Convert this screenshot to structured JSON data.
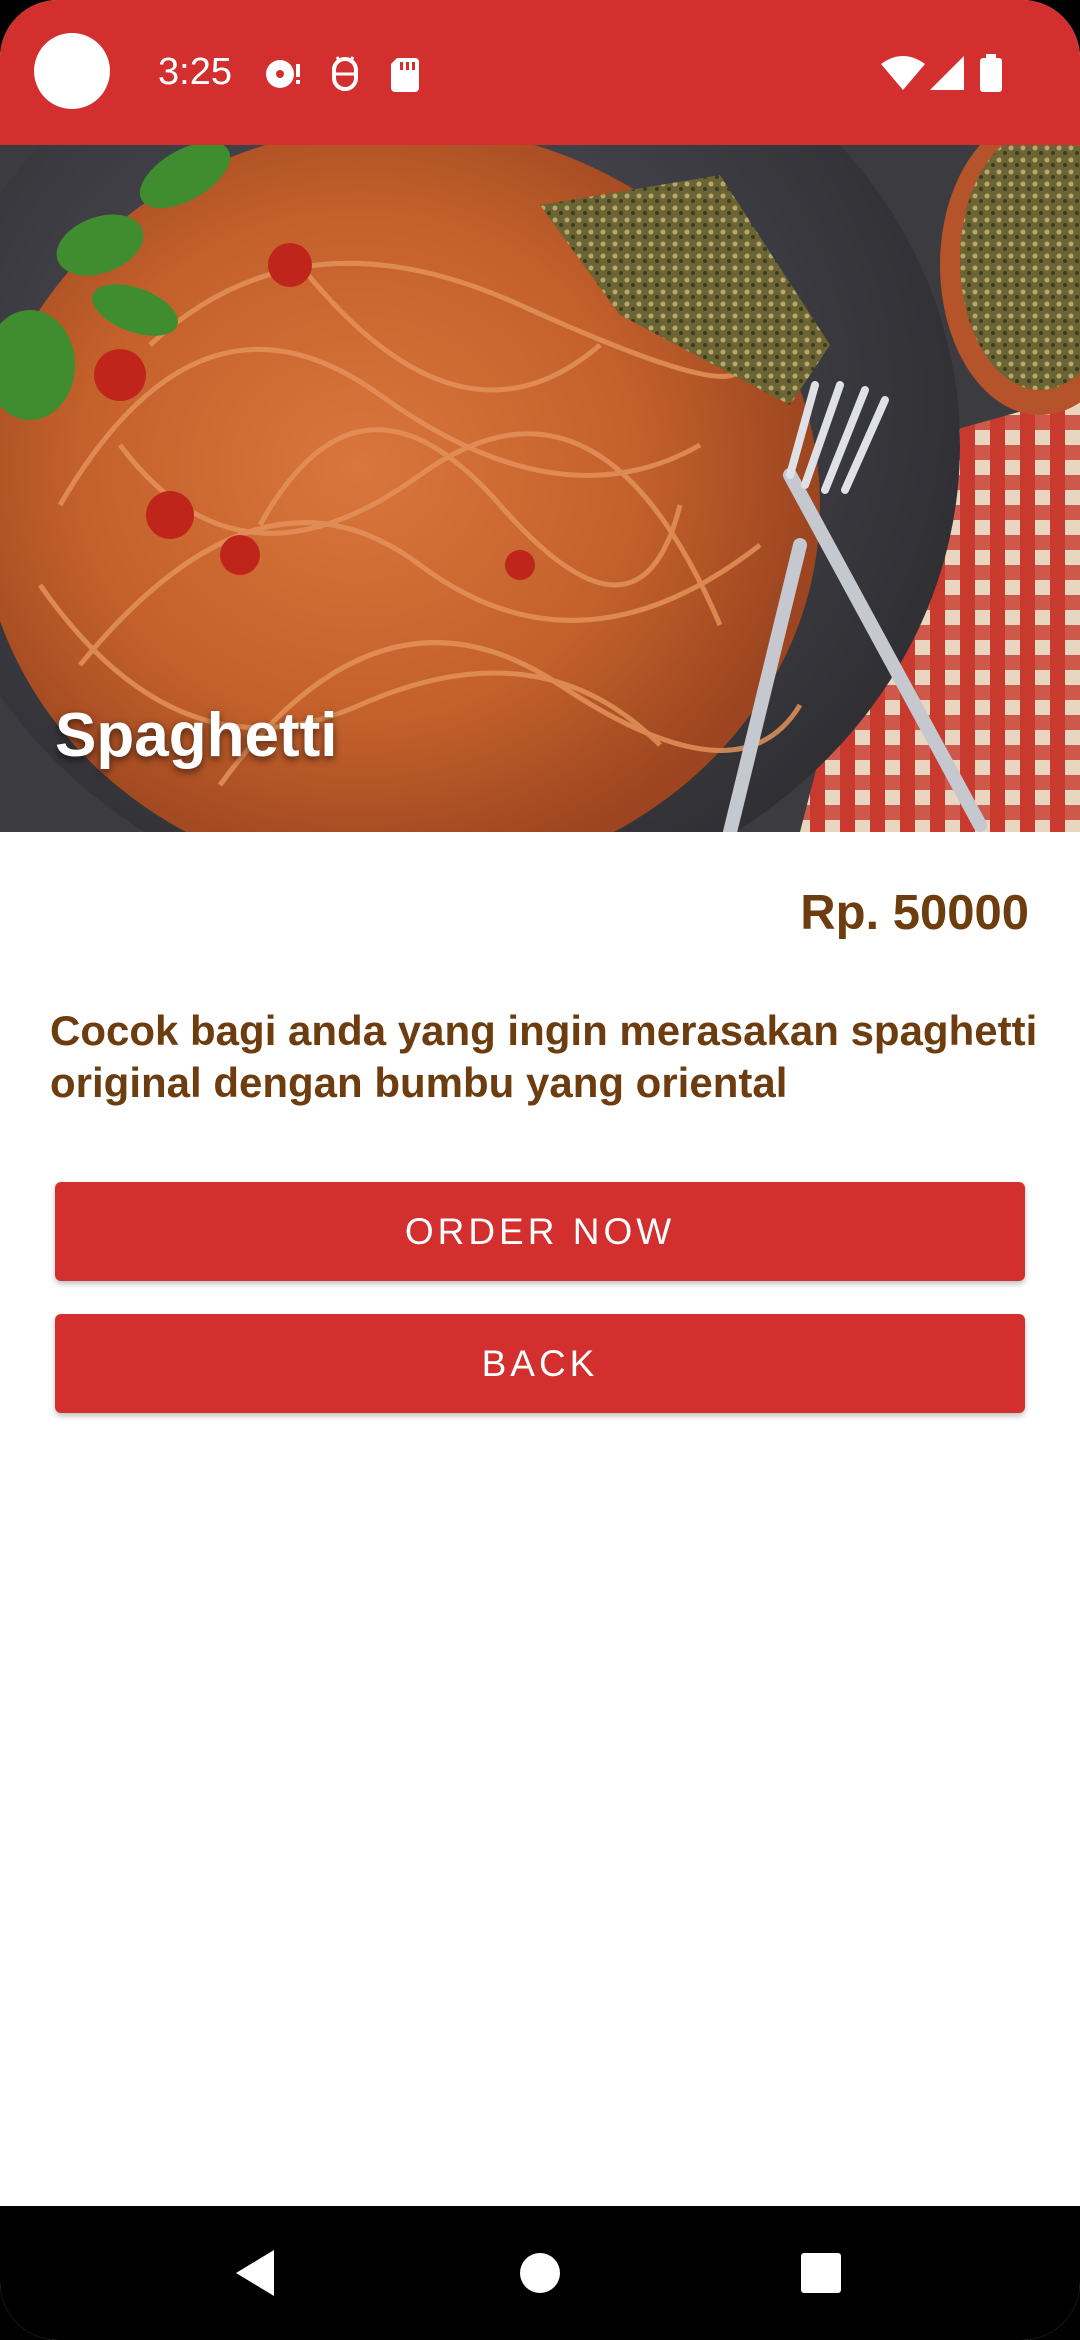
{
  "status_bar": {
    "time": "3:25",
    "color": "#d32f2f",
    "icons": [
      "notification-disc-icon",
      "android-debug-icon",
      "sd-card-icon",
      "wifi-icon",
      "cell-signal-icon",
      "battery-icon"
    ]
  },
  "hero": {
    "image": "spaghetti-plate-photo",
    "title": "Spaghetti"
  },
  "product": {
    "price": "Rp. 50000",
    "description": "Cocok bagi anda yang ingin merasakan spaghetti original dengan bumbu yang oriental"
  },
  "actions": {
    "order_label": "ORDER NOW",
    "back_label": "BACK"
  },
  "colors": {
    "primary": "#d32f2f",
    "text_brown": "#6d3d10"
  },
  "nav_bar": {
    "icons": [
      "back-triangle-icon",
      "home-circle-icon",
      "recents-square-icon"
    ]
  }
}
